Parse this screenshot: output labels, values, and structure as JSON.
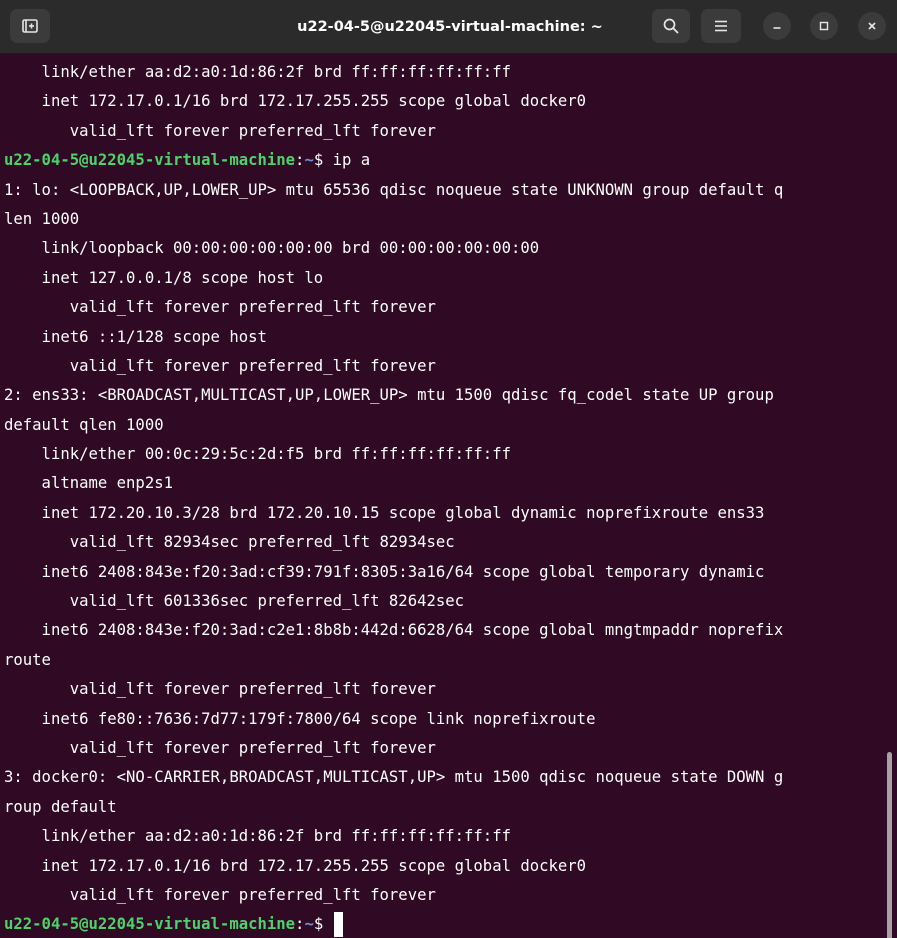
{
  "window": {
    "title": "u22-04-5@u22045-virtual-machine: ~"
  },
  "icons": {
    "new_tab": "new-tab-icon",
    "search": "search-icon",
    "menu": "hamburger-menu-icon",
    "minimize": "minimize-icon",
    "maximize": "maximize-icon",
    "close": "close-icon"
  },
  "colors": {
    "background": "#300a24",
    "prompt_user": "#4bd36a",
    "prompt_path": "#6f8fd0",
    "text": "#ffffff",
    "titlebar": "#2b2b2b"
  },
  "terminal": {
    "lines": [
      {
        "type": "out",
        "text": "    link/ether aa:d2:a0:1d:86:2f brd ff:ff:ff:ff:ff:ff"
      },
      {
        "type": "out",
        "text": "    inet 172.17.0.1/16 brd 172.17.255.255 scope global docker0"
      },
      {
        "type": "out",
        "text": "       valid_lft forever preferred_lft forever"
      },
      {
        "type": "prompt",
        "user": "u22-04-5@u22045-virtual-machine",
        "sep": ":",
        "path": "~",
        "symbol": "$ ",
        "cmd": "ip a"
      },
      {
        "type": "out",
        "text": "1: lo: <LOOPBACK,UP,LOWER_UP> mtu 65536 qdisc noqueue state UNKNOWN group default q"
      },
      {
        "type": "out",
        "text": "len 1000"
      },
      {
        "type": "out",
        "text": "    link/loopback 00:00:00:00:00:00 brd 00:00:00:00:00:00"
      },
      {
        "type": "out",
        "text": "    inet 127.0.0.1/8 scope host lo"
      },
      {
        "type": "out",
        "text": "       valid_lft forever preferred_lft forever"
      },
      {
        "type": "out",
        "text": "    inet6 ::1/128 scope host"
      },
      {
        "type": "out",
        "text": "       valid_lft forever preferred_lft forever"
      },
      {
        "type": "out",
        "text": "2: ens33: <BROADCAST,MULTICAST,UP,LOWER_UP> mtu 1500 qdisc fq_codel state UP group"
      },
      {
        "type": "out",
        "text": "default qlen 1000"
      },
      {
        "type": "out",
        "text": "    link/ether 00:0c:29:5c:2d:f5 brd ff:ff:ff:ff:ff:ff"
      },
      {
        "type": "out",
        "text": "    altname enp2s1"
      },
      {
        "type": "out",
        "text": "    inet 172.20.10.3/28 brd 172.20.10.15 scope global dynamic noprefixroute ens33"
      },
      {
        "type": "out",
        "text": "       valid_lft 82934sec preferred_lft 82934sec"
      },
      {
        "type": "out",
        "text": "    inet6 2408:843e:f20:3ad:cf39:791f:8305:3a16/64 scope global temporary dynamic"
      },
      {
        "type": "out",
        "text": "       valid_lft 601336sec preferred_lft 82642sec"
      },
      {
        "type": "out",
        "text": "    inet6 2408:843e:f20:3ad:c2e1:8b8b:442d:6628/64 scope global mngtmpaddr noprefix"
      },
      {
        "type": "out",
        "text": "route"
      },
      {
        "type": "out",
        "text": "       valid_lft forever preferred_lft forever"
      },
      {
        "type": "out",
        "text": "    inet6 fe80::7636:7d77:179f:7800/64 scope link noprefixroute"
      },
      {
        "type": "out",
        "text": "       valid_lft forever preferred_lft forever"
      },
      {
        "type": "out",
        "text": "3: docker0: <NO-CARRIER,BROADCAST,MULTICAST,UP> mtu 1500 qdisc noqueue state DOWN g"
      },
      {
        "type": "out",
        "text": "roup default"
      },
      {
        "type": "out",
        "text": "    link/ether aa:d2:a0:1d:86:2f brd ff:ff:ff:ff:ff:ff"
      },
      {
        "type": "out",
        "text": "    inet 172.17.0.1/16 brd 172.17.255.255 scope global docker0"
      },
      {
        "type": "out",
        "text": "       valid_lft forever preferred_lft forever"
      },
      {
        "type": "prompt",
        "user": "u22-04-5@u22045-virtual-machine",
        "sep": ":",
        "path": "~",
        "symbol": "$ ",
        "cmd": "",
        "cursor": true
      }
    ]
  }
}
